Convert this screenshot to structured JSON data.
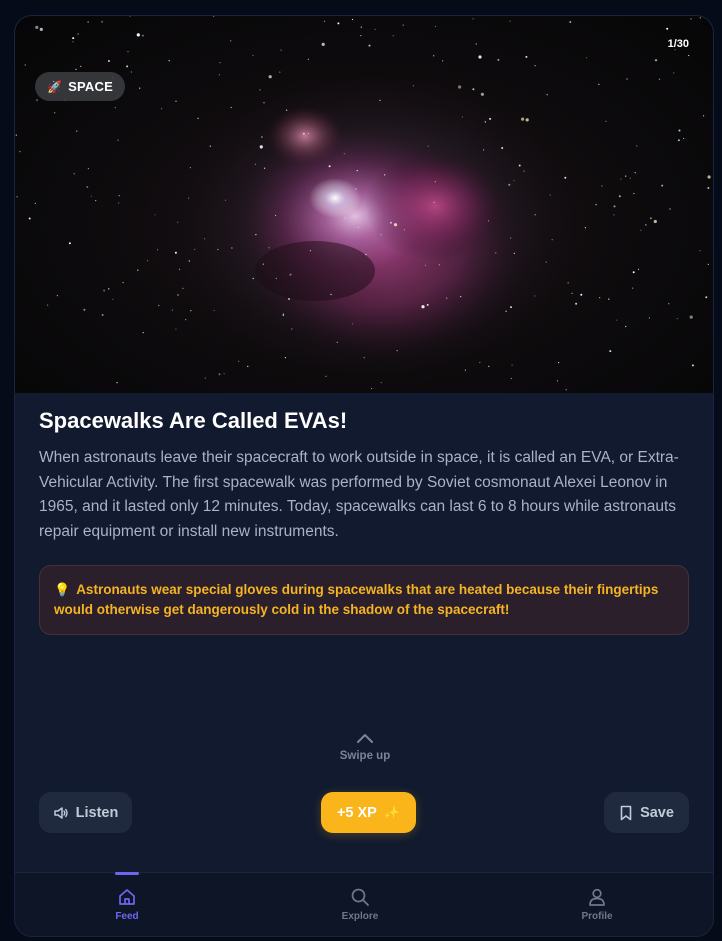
{
  "card": {
    "category": "SPACE",
    "category_icon": "rocket-icon",
    "counter": "1/30",
    "title": "Spacewalks Are Called EVAs!",
    "body": "When astronauts leave their spacecraft to work outside in space, it is called an EVA, or Extra-Vehicular Activity. The first spacewalk was performed by Soviet cosmonaut Alexei Leonov in 1965, and it lasted only 12 minutes. Today, spacewalks can last 6 to 8 hours while astronauts repair equipment or install new instruments.",
    "fact": "Astronauts wear special gloves during spacewalks that are heated because their fingertips would otherwise get dangerously cold in the shadow of the spacecraft!",
    "fact_icon": "lightbulb-icon"
  },
  "swipe": {
    "label": "Swipe up",
    "icon": "chevron-up-icon"
  },
  "actions": {
    "listen_label": "Listen",
    "xp_label": "+5 XP",
    "save_label": "Save"
  },
  "nav": {
    "items": [
      {
        "label": "Feed",
        "icon": "home-icon",
        "active": true
      },
      {
        "label": "Explore",
        "icon": "search-icon",
        "active": false
      },
      {
        "label": "Profile",
        "icon": "user-icon",
        "active": false
      }
    ]
  },
  "colors": {
    "accent": "#6c67f0",
    "xp": "#f9b51a",
    "fact_text": "#f5b424",
    "card_bg": "#111a2e",
    "page_bg": "#060b1a"
  }
}
